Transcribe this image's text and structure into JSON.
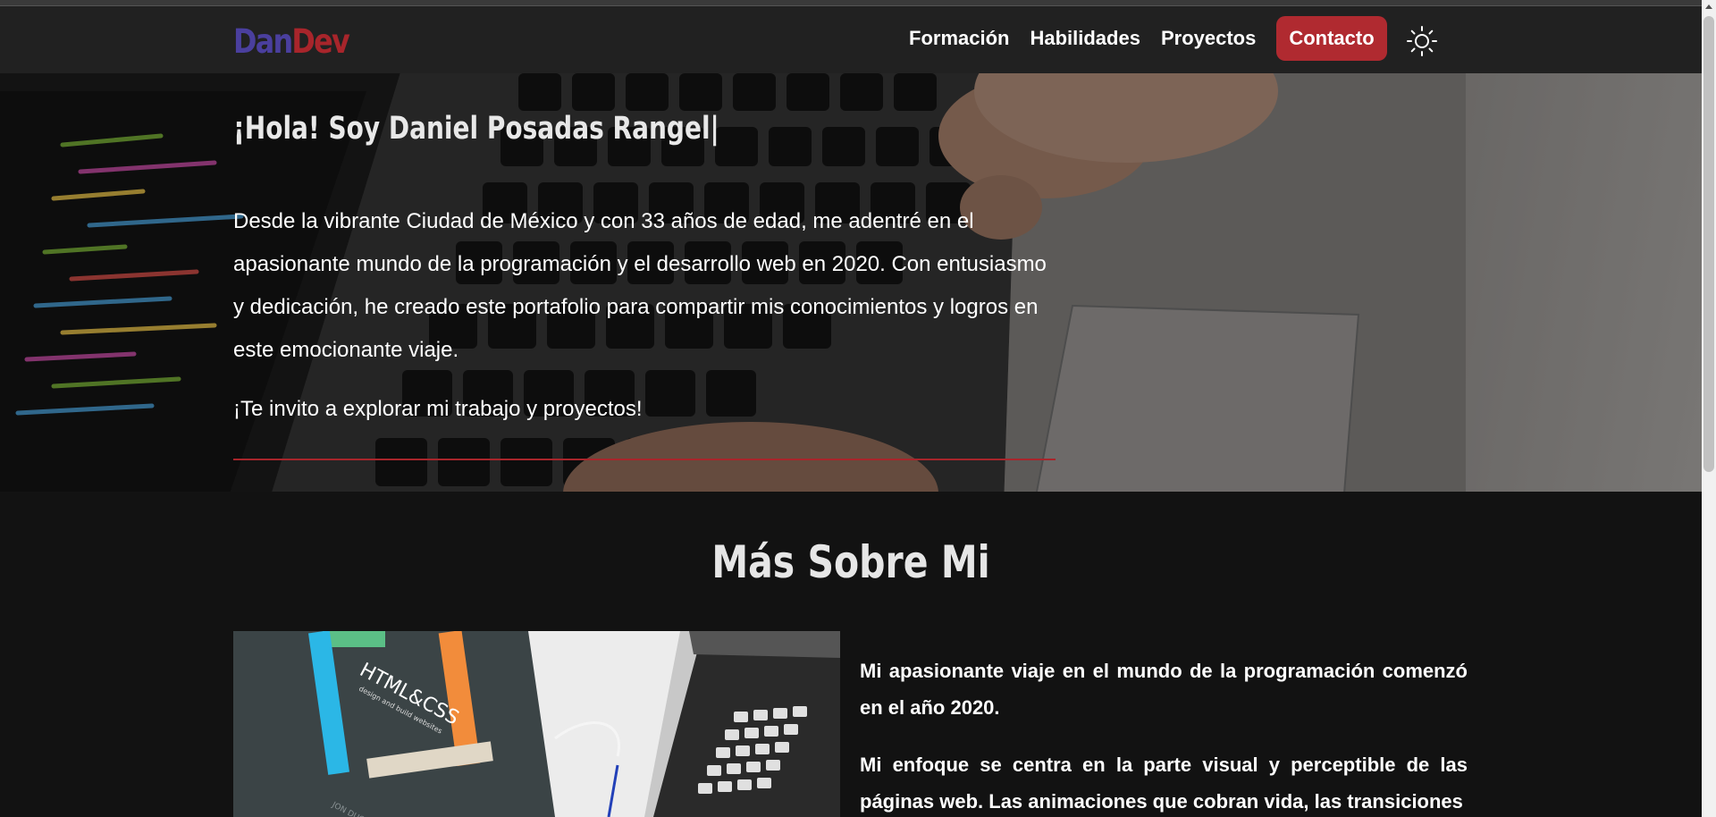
{
  "header": {
    "logo_part1": "Dan",
    "logo_part2": "Dev",
    "nav": [
      "Formación",
      "Habilidades",
      "Proyectos"
    ],
    "contact_label": "Contacto",
    "theme_icon": "sun-icon"
  },
  "hero": {
    "title": "¡Hola! Soy Daniel Posadas Rangel|",
    "paragraph": "Desde la vibrante Ciudad de México y con 33 años de edad, me adentré en el apasionante mundo de la programación y el desarrollo web en 2020. Con entusiasmo y dedicación, he creado este portafolio para compartir mis conocimientos y logros en este emocionante viaje.",
    "invite": "¡Te invito a explorar mi trabajo y proyectos!"
  },
  "about": {
    "title": "Más Sobre Mi",
    "paragraph1": "Mi apasionante viaje en el mundo de la programación comenzó en el año 2020.",
    "paragraph2": "Mi enfoque se centra en la parte visual y perceptible de las páginas web. Las animaciones que cobran vida, las transiciones",
    "image_book_title": "HTML&CSS",
    "image_book_subtitle": "design and build websites",
    "image_book_author": "JON DUCKETT"
  },
  "colors": {
    "accent": "#b02a30",
    "logo_primary": "#4a3f9e",
    "logo_secondary": "#a8252b",
    "navbar_bg": "#212121",
    "page_bg": "#121212"
  }
}
